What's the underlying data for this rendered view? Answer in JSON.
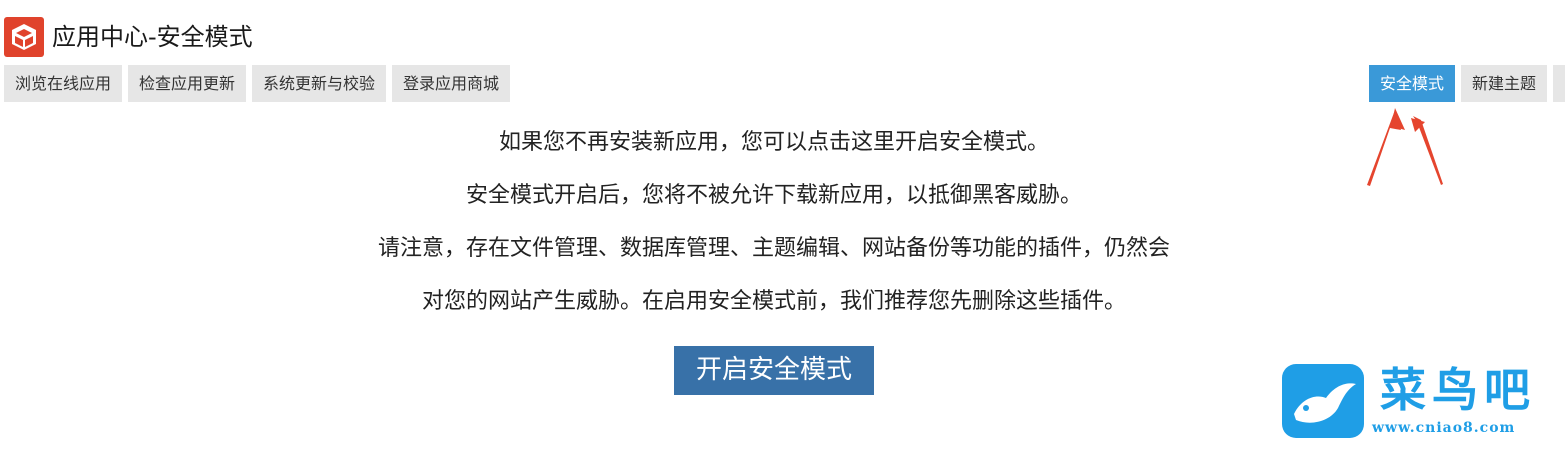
{
  "header": {
    "title": "应用中心-安全模式",
    "icon": "app-center-box-icon"
  },
  "tabs_left": [
    {
      "label": "浏览在线应用"
    },
    {
      "label": "检查应用更新"
    },
    {
      "label": "系统更新与校验"
    },
    {
      "label": "登录应用商城"
    }
  ],
  "tabs_right": [
    {
      "label": "安全模式",
      "active": true
    },
    {
      "label": "新建主题",
      "active": false
    }
  ],
  "content": {
    "lines": [
      "如果您不再安装新应用，您可以点击这里开启安全模式。",
      "安全模式开启后，您将不被允许下载新应用，以抵御黑客威胁。",
      "请注意，存在文件管理、数据库管理、主题编辑、网站备份等功能的插件，仍然会",
      "对您的网站产生威胁。在启用安全模式前，我们推荐您先删除这些插件。"
    ],
    "button_label": "开启安全模式"
  },
  "watermark": {
    "text": "菜鸟吧",
    "url": "www.cniao8.com"
  },
  "colors": {
    "active_tab": "#3a99d8",
    "primary_button": "#3871a8",
    "tab_bg": "#e6e6e6",
    "arrow": "#e5452e",
    "brand_red": "#e0432c",
    "watermark_blue": "#1f9ee6"
  }
}
